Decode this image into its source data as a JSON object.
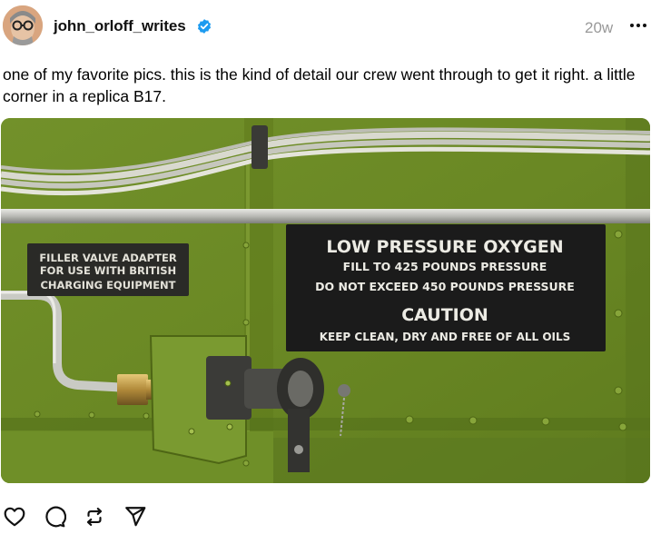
{
  "post": {
    "username": "john_orloff_writes",
    "timestamp": "20w",
    "caption": "one of my favorite pics. this is the kind of detail our crew went through to get it right. a little corner in a replica B17."
  },
  "photo": {
    "left_placard": {
      "line1": "FILLER VALVE ADAPTER",
      "line2": "FOR USE WITH BRITISH",
      "line3": "CHARGING EQUIPMENT"
    },
    "right_placard": {
      "title": "LOW PRESSURE OXYGEN",
      "line1": "FILL TO 425 POUNDS PRESSURE",
      "line2": "DO NOT EXCEED 450 POUNDS PRESSURE",
      "caution": "CAUTION",
      "line3": "KEEP CLEAN, DRY AND FREE OF ALL OILS"
    }
  },
  "icons": {
    "verified": "verified-badge-icon",
    "more": "more-options-icon",
    "like": "heart-icon",
    "comment": "comment-icon",
    "repost": "repost-icon",
    "share": "share-icon"
  },
  "colors": {
    "verified": "#1d9bf0",
    "panel_green": "#6c8a25",
    "placard_black": "#1b1b1b"
  }
}
